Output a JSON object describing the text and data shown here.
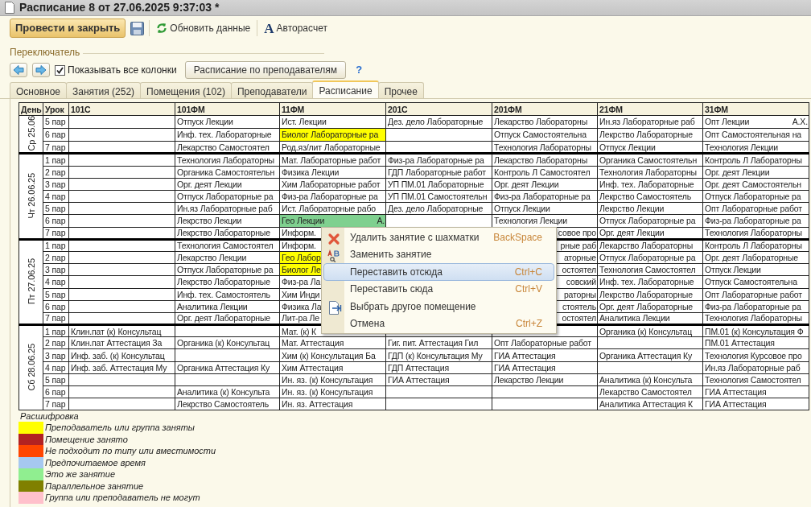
{
  "window": {
    "title": "Расписание 8 от 27.06.2025 9:37:03 *"
  },
  "toolbar": {
    "primary_button": "Провести и закрыть",
    "refresh_button": "Обновить данные",
    "autocalc_button": {
      "glyph": "A",
      "label": "Авторасчет"
    }
  },
  "switcher": {
    "title": "Переключатель",
    "show_all_columns": {
      "label": "Показывать все колонки",
      "checked": true
    },
    "teacher_button": "Расписание по преподавателям",
    "help": "?"
  },
  "tabs": [
    {
      "label": "Основное",
      "selected": false
    },
    {
      "label": "Занятия (252)",
      "selected": false
    },
    {
      "label": "Помещения (102)",
      "selected": false
    },
    {
      "label": "Преподаватели",
      "selected": false
    },
    {
      "label": "Расписание",
      "selected": true
    },
    {
      "label": "Прочее",
      "selected": false
    }
  ],
  "schedule": {
    "columns": [
      "День",
      "Урок",
      "101С",
      "101ФМ",
      "11ФМ",
      "201С",
      "201ФМ",
      "21ФМ",
      "31ФМ"
    ],
    "days": [
      {
        "day": "Ср 25.06",
        "lessons": [
          {
            "lesson": "5 пар",
            "cells": [
              null,
              "Отпуск Лекции",
              "Ист. Лекции",
              "Дез. дело Лабораторные",
              "Лекарство Лабораторны",
              "Ин.яз Лабораторные раб",
              {
                "text": "Опт Лекции",
                "note": "А.Х."
              }
            ]
          },
          {
            "lesson": "6 пар",
            "cells": [
              null,
              "Инф. тех. Лабораторные",
              {
                "text": "Биолог Лабораторные ра",
                "color": "#ffff00"
              },
              null,
              "Отпуск Самостоятельна",
              "Лекрство Лабораторные",
              "Опт Самостоятельная на"
            ]
          },
          {
            "lesson": "7 пар",
            "cells": [
              null,
              "Лекарство Самостоятел",
              "Род.яз/лит Лабораторные",
              null,
              "Технология Лабораторны",
              "Отпуск Лекции",
              "Технология Лекции"
            ]
          }
        ]
      },
      {
        "day": "Чт 26.06.25",
        "lessons": [
          {
            "lesson": "1 пар",
            "cells": [
              null,
              "Технология Лабораторны",
              "Мат. Лабораторные работ",
              "Физ-ра Лабораторные ра",
              "Лекарство Лабораторны",
              "Органика Самостоятельн",
              "Контроль Л Лабораторны"
            ]
          },
          {
            "lesson": "2 пар",
            "cells": [
              null,
              "Органика Самостоятельн",
              "Физика Лекции",
              "ГДП Лабораторные работ",
              "Контроль Л Самостоятел",
              "Технология Лабораторны",
              "Орг. деят Лекции"
            ]
          },
          {
            "lesson": "3 пар",
            "cells": [
              null,
              "Орг. деят Лекции",
              "Хим Лабораторные работ",
              "УП ПМ.01 Лабораторные",
              "Орг. деят Лекции",
              "Инф. тех. Лабораторные",
              "Орг. деят Самостоятельн"
            ]
          },
          {
            "lesson": "4 пар",
            "cells": [
              null,
              "Отпуск Лабораторные ра",
              "Физ-ра Лабораторные ра",
              "УП ПМ.01 Самостоятельн",
              "Физ-ра Лабораторные ра",
              "Лекрство Самостоятель",
              "Отпуск Лабораторные ра"
            ]
          },
          {
            "lesson": "5 пар",
            "cells": [
              null,
              "Ин.яз Лабораторные раб",
              "Ист. Лабораторные рабо",
              "Дез. дело Лабораторные",
              "Отпуск Лекции",
              "Лекрство Лекции",
              "Опт Лабораторные работ"
            ]
          },
          {
            "lesson": "6 пар",
            "cells": [
              null,
              "Лекрство Лекции",
              {
                "text": "Гео Лекции",
                "note": "А.",
                "color": "#7fd08f"
              },
              null,
              "Технология Лекции",
              "Отпуск Лабораторные ра",
              "Физ-ра Лабораторные ра"
            ]
          },
          {
            "lesson": "7 пар",
            "cells": [
              null,
              "Лекрство Лабораторные",
              "Информ.",
              null,
              {
                "text": "совое про",
                "kind": "partial"
              },
              "Орг. деят Лекции",
              "Технология Лабораторны"
            ]
          }
        ]
      },
      {
        "day": "Пт 27.06.25",
        "lessons": [
          {
            "lesson": "1 пар",
            "cells": [
              null,
              "Технология Самостоятел",
              "Информ.",
              null,
              {
                "text": "рные раб",
                "kind": "partial"
              },
              "Лекарство Лабораторны",
              "Контроль Л Лабораторны"
            ]
          },
          {
            "lesson": "2 пар",
            "cells": [
              null,
              "Лекарство Лекции",
              {
                "text": "Гео Лабор",
                "color": "#ffff00"
              },
              null,
              {
                "text": "аторные",
                "kind": "partial"
              },
              "Отпуск Лабораторные ра",
              "Орг. деят Лабораторные"
            ]
          },
          {
            "lesson": "3 пар",
            "cells": [
              null,
              "Отпуск Лабораторные ра",
              {
                "text": "Биолог Ле",
                "color": "#ffff00"
              },
              null,
              {
                "text": "остоятел",
                "kind": "partial"
              },
              "Технология Самостоятел",
              "Отпуск Лекции"
            ]
          },
          {
            "lesson": "4 пар",
            "cells": [
              null,
              "Лекрство Лабораторные",
              "Физ-ра Ла",
              null,
              {
                "text": "совский",
                "kind": "partial"
              },
              "Инф. тех. Лабораторные",
              "Отпуск Самостоятельна"
            ]
          },
          {
            "lesson": "5 пар",
            "cells": [
              null,
              "Инф. тех. Самостоятель",
              "Хим Инди",
              null,
              {
                "text": "раторны",
                "kind": "partial"
              },
              "Лекрство Лабораторные",
              "Опт Лабораторные работ"
            ]
          },
          {
            "lesson": "6 пар",
            "cells": [
              null,
              "Аналитика Лекции",
              "Физика Ла",
              null,
              {
                "text": "стоятель",
                "kind": "partial"
              },
              "Орг. деят Лабораторные",
              "Физ-ра Лабораторные ра"
            ]
          },
          {
            "lesson": "7 пар",
            "cells": [
              null,
              "Орг. деят Лабораторные",
              "Лит-ра Ле",
              null,
              {
                "text": "остоятел",
                "kind": "partial"
              },
              "Аналитика Лекции",
              "Технология Лабораторны"
            ]
          }
        ]
      },
      {
        "day": "Сб 28.06.25",
        "lessons": [
          {
            "lesson": "1 пар",
            "cells": [
              "Клин.пат (к) Консультац",
              null,
              "Мат. (к) К",
              null,
              null,
              "Органика (к) Консультац",
              "ПМ.01 (к) Консультация Ф"
            ]
          },
          {
            "lesson": "2 пар",
            "cells": [
              "Клин.пат Аттестация За",
              "Органика (к) Консультац",
              "Мат. Аттестация",
              "Гиг. пит. Аттестация Гил",
              "Опт Лабораторные работ",
              null,
              "ПМ.01 Аттестация"
            ]
          },
          {
            "lesson": "3 пар",
            "cells": [
              "Инф. заб. (к) Консультац",
              null,
              "Хим (к) Консультация Ба",
              "ГДП (к) Консультация Му",
              "ГИА Аттестация",
              "Органика Аттестация Ку",
              "Технология Курсовое про"
            ]
          },
          {
            "lesson": "4 пар",
            "cells": [
              "Инф. заб. Аттестация Му",
              "Органика Аттестация Ку",
              "Хим Аттестация",
              "ГДП Аттестация",
              "ГИА Аттестация",
              null,
              "Ин.яз Лабораторные раб"
            ]
          },
          {
            "lesson": "5 пар",
            "cells": [
              null,
              null,
              "Ин. яз. (к) Консультация",
              "ГИА Аттестация",
              "Лекарство Лекции",
              "Аналитика (к) Консульта",
              "Технология Самостоятел"
            ]
          },
          {
            "lesson": "6 пар",
            "cells": [
              null,
              "Аналитика (к) Консульта",
              "Ин. яз. (к) Консультация",
              null,
              null,
              "Лекарство Самостоятел",
              "ГИА Аттестация"
            ]
          },
          {
            "lesson": "7 пар",
            "cells": [
              null,
              "Лекрство Самостоятель",
              "Ин. яз. Аттестация",
              null,
              null,
              "Аналитика Аттестация К",
              "ГИА Аттестация"
            ]
          }
        ]
      }
    ]
  },
  "context_menu": {
    "items": [
      {
        "kind": "delete",
        "label": "Удалить занятие с шахматки",
        "shortcut": "BackSpace",
        "selected": false
      },
      {
        "kind": "replace",
        "label": "Заменить занятие",
        "selected": false
      },
      {
        "kind": "plain",
        "label": "Переставить отсюда",
        "shortcut": "Ctrl+C",
        "selected": true
      },
      {
        "kind": "plain",
        "label": "Переставить сюда",
        "shortcut": "Ctrl+V",
        "selected": false
      },
      {
        "kind": "move",
        "label": "Выбрать другое помещение",
        "selected": false
      },
      {
        "kind": "plain",
        "label": "Отмена",
        "shortcut": "Ctrl+Z",
        "selected": false
      }
    ]
  },
  "legend": {
    "title": "Расшифровка",
    "items": [
      {
        "label": "Преподаватель или группа заняты",
        "color": "#ffff00"
      },
      {
        "label": "Помещение занято",
        "color": "#b22222"
      },
      {
        "label": "Не подходит по типу или вместимости",
        "color": "#ff4500"
      },
      {
        "label": "Предпочитаемое время",
        "color": "#a6c8f0"
      },
      {
        "label": "Это же занятие",
        "color": "#90ee90"
      },
      {
        "label": "Параллельное занятие",
        "color": "#808000"
      },
      {
        "label": "Группа или преподаватель не могут",
        "color": "#ffc0cb"
      }
    ]
  }
}
